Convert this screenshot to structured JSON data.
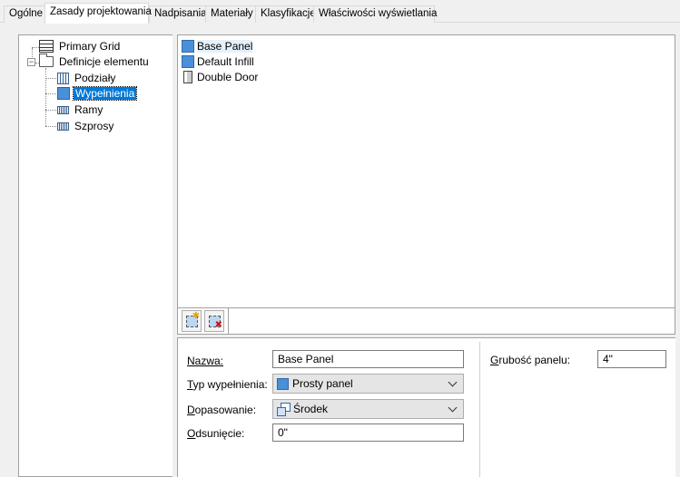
{
  "tabs": [
    {
      "label": "Ogólne",
      "active": false
    },
    {
      "label": "Zasady projektowania",
      "active": true
    },
    {
      "label": "Nadpisania",
      "active": false
    },
    {
      "label": "Materiały",
      "active": false
    },
    {
      "label": "Klasyfikacje",
      "active": false
    },
    {
      "label": "Właściwości wyświetlania",
      "active": false
    }
  ],
  "tree": {
    "items": [
      {
        "label": "Primary Grid",
        "icon": "grid-icon"
      },
      {
        "label": "Definicje elementu",
        "icon": "folder-icon",
        "expanded": true
      },
      {
        "label": "Podziały",
        "icon": "division-icon"
      },
      {
        "label": "Wypełnienia",
        "icon": "infill-icon",
        "selected": true
      },
      {
        "label": "Ramy",
        "icon": "frame-icon"
      },
      {
        "label": "Szprosy",
        "icon": "mullion-icon"
      }
    ]
  },
  "list": {
    "items": [
      {
        "label": "Base Panel",
        "icon": "panel-icon",
        "selected": true
      },
      {
        "label": "Default Infill",
        "icon": "panel-icon"
      },
      {
        "label": "Double Door",
        "icon": "door-icon"
      }
    ]
  },
  "toolbar": {
    "add_tooltip": "new-item",
    "delete_tooltip": "delete-item"
  },
  "properties": {
    "name_label": "Nazwa:",
    "name_value": "Base Panel",
    "infill_type_label_u": "T",
    "infill_type_label_rest": "yp wypełnienia:",
    "infill_type_value": "Prosty panel",
    "alignment_label_u": "D",
    "alignment_label_rest": "opasowanie:",
    "alignment_value": "Środek",
    "offset_label_u": "O",
    "offset_label_rest": "dsunięcie:",
    "offset_value": "0\"",
    "thickness_label_u": "G",
    "thickness_label_rest": "rubość panelu:",
    "thickness_value": "4\""
  },
  "colors": {
    "selection": "#0078d7",
    "panel_blue": "#4a90d9"
  }
}
